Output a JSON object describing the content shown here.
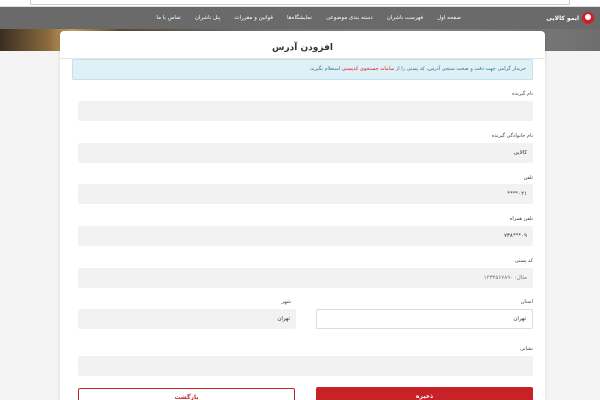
{
  "header": {
    "brand_name": "ایمو کالایی",
    "nav": [
      "صفحه اول",
      "فهرست ناشران",
      "دسته بندی موضوعی",
      "نمایشگاه‌ها",
      "قوانین و مقررات",
      "پنل ناشران",
      "تماس با ما"
    ]
  },
  "form": {
    "title": "افزودن آدرس",
    "alert_text": "خریدار گرامی جهت دقت و صحت سنجی آدرس، کد پستی را از ",
    "alert_link": "سامانه جستجوی کدپستی",
    "alert_suffix": " استعلام بگیرید.",
    "fields": {
      "first_name": {
        "label": "نام گیرنده",
        "value": ""
      },
      "last_name": {
        "label": "نام خانوادگی گیرنده",
        "value": "کالایی"
      },
      "phone": {
        "label": "تلفن",
        "value": "۰۲۱****"
      },
      "mobile": {
        "label": "تلفن همراه",
        "value": "۰۹***۷۳۸"
      },
      "postal_code": {
        "label": "کد پستی",
        "placeholder": "مثال: ۱۲۳۴۵۶۷۸۹۰"
      },
      "province": {
        "label": "استان",
        "value": "تهران"
      },
      "city": {
        "label": "شهر",
        "value": "تهران"
      },
      "address": {
        "label": "نشانی",
        "value": ""
      }
    },
    "save_label": "ذخیره",
    "back_label": "بازگشت"
  }
}
